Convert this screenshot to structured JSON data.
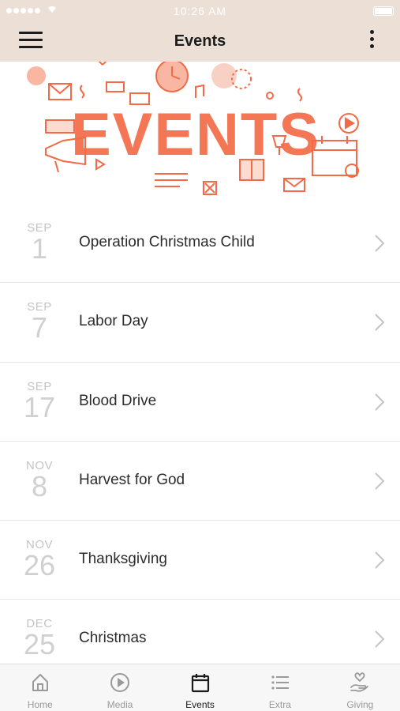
{
  "status_bar": {
    "time": "10:26 AM"
  },
  "header": {
    "title": "Events"
  },
  "banner": {
    "word": "EVENTS",
    "accent_color": "#f26a47"
  },
  "events": [
    {
      "month": "SEP",
      "day": "1",
      "name": "Operation Christmas Child"
    },
    {
      "month": "SEP",
      "day": "7",
      "name": "Labor Day"
    },
    {
      "month": "SEP",
      "day": "17",
      "name": "Blood Drive"
    },
    {
      "month": "NOV",
      "day": "8",
      "name": "Harvest for God"
    },
    {
      "month": "NOV",
      "day": "26",
      "name": "Thanksgiving"
    },
    {
      "month": "DEC",
      "day": "25",
      "name": "Christmas"
    }
  ],
  "tabs": [
    {
      "label": "Home",
      "icon": "home-icon",
      "active": false
    },
    {
      "label": "Media",
      "icon": "play-circle-icon",
      "active": false
    },
    {
      "label": "Events",
      "icon": "calendar-icon",
      "active": true
    },
    {
      "label": "Extra",
      "icon": "list-icon",
      "active": false
    },
    {
      "label": "Giving",
      "icon": "giving-hand-icon",
      "active": false
    }
  ],
  "colors": {
    "nav_background": "#ece0d6",
    "accent": "#f26a47"
  }
}
